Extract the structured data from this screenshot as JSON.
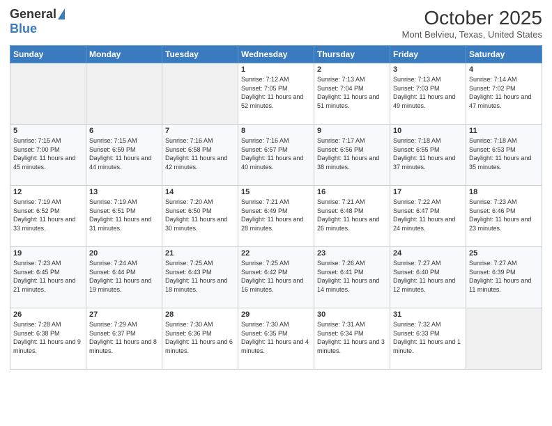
{
  "header": {
    "logo_general": "General",
    "logo_blue": "Blue",
    "month_title": "October 2025",
    "subtitle": "Mont Belvieu, Texas, United States"
  },
  "weekdays": [
    "Sunday",
    "Monday",
    "Tuesday",
    "Wednesday",
    "Thursday",
    "Friday",
    "Saturday"
  ],
  "weeks": [
    [
      {
        "day": "",
        "info": ""
      },
      {
        "day": "",
        "info": ""
      },
      {
        "day": "",
        "info": ""
      },
      {
        "day": "1",
        "info": "Sunrise: 7:12 AM\nSunset: 7:05 PM\nDaylight: 11 hours and 52 minutes."
      },
      {
        "day": "2",
        "info": "Sunrise: 7:13 AM\nSunset: 7:04 PM\nDaylight: 11 hours and 51 minutes."
      },
      {
        "day": "3",
        "info": "Sunrise: 7:13 AM\nSunset: 7:03 PM\nDaylight: 11 hours and 49 minutes."
      },
      {
        "day": "4",
        "info": "Sunrise: 7:14 AM\nSunset: 7:02 PM\nDaylight: 11 hours and 47 minutes."
      }
    ],
    [
      {
        "day": "5",
        "info": "Sunrise: 7:15 AM\nSunset: 7:00 PM\nDaylight: 11 hours and 45 minutes."
      },
      {
        "day": "6",
        "info": "Sunrise: 7:15 AM\nSunset: 6:59 PM\nDaylight: 11 hours and 44 minutes."
      },
      {
        "day": "7",
        "info": "Sunrise: 7:16 AM\nSunset: 6:58 PM\nDaylight: 11 hours and 42 minutes."
      },
      {
        "day": "8",
        "info": "Sunrise: 7:16 AM\nSunset: 6:57 PM\nDaylight: 11 hours and 40 minutes."
      },
      {
        "day": "9",
        "info": "Sunrise: 7:17 AM\nSunset: 6:56 PM\nDaylight: 11 hours and 38 minutes."
      },
      {
        "day": "10",
        "info": "Sunrise: 7:18 AM\nSunset: 6:55 PM\nDaylight: 11 hours and 37 minutes."
      },
      {
        "day": "11",
        "info": "Sunrise: 7:18 AM\nSunset: 6:53 PM\nDaylight: 11 hours and 35 minutes."
      }
    ],
    [
      {
        "day": "12",
        "info": "Sunrise: 7:19 AM\nSunset: 6:52 PM\nDaylight: 11 hours and 33 minutes."
      },
      {
        "day": "13",
        "info": "Sunrise: 7:19 AM\nSunset: 6:51 PM\nDaylight: 11 hours and 31 minutes."
      },
      {
        "day": "14",
        "info": "Sunrise: 7:20 AM\nSunset: 6:50 PM\nDaylight: 11 hours and 30 minutes."
      },
      {
        "day": "15",
        "info": "Sunrise: 7:21 AM\nSunset: 6:49 PM\nDaylight: 11 hours and 28 minutes."
      },
      {
        "day": "16",
        "info": "Sunrise: 7:21 AM\nSunset: 6:48 PM\nDaylight: 11 hours and 26 minutes."
      },
      {
        "day": "17",
        "info": "Sunrise: 7:22 AM\nSunset: 6:47 PM\nDaylight: 11 hours and 24 minutes."
      },
      {
        "day": "18",
        "info": "Sunrise: 7:23 AM\nSunset: 6:46 PM\nDaylight: 11 hours and 23 minutes."
      }
    ],
    [
      {
        "day": "19",
        "info": "Sunrise: 7:23 AM\nSunset: 6:45 PM\nDaylight: 11 hours and 21 minutes."
      },
      {
        "day": "20",
        "info": "Sunrise: 7:24 AM\nSunset: 6:44 PM\nDaylight: 11 hours and 19 minutes."
      },
      {
        "day": "21",
        "info": "Sunrise: 7:25 AM\nSunset: 6:43 PM\nDaylight: 11 hours and 18 minutes."
      },
      {
        "day": "22",
        "info": "Sunrise: 7:25 AM\nSunset: 6:42 PM\nDaylight: 11 hours and 16 minutes."
      },
      {
        "day": "23",
        "info": "Sunrise: 7:26 AM\nSunset: 6:41 PM\nDaylight: 11 hours and 14 minutes."
      },
      {
        "day": "24",
        "info": "Sunrise: 7:27 AM\nSunset: 6:40 PM\nDaylight: 11 hours and 12 minutes."
      },
      {
        "day": "25",
        "info": "Sunrise: 7:27 AM\nSunset: 6:39 PM\nDaylight: 11 hours and 11 minutes."
      }
    ],
    [
      {
        "day": "26",
        "info": "Sunrise: 7:28 AM\nSunset: 6:38 PM\nDaylight: 11 hours and 9 minutes."
      },
      {
        "day": "27",
        "info": "Sunrise: 7:29 AM\nSunset: 6:37 PM\nDaylight: 11 hours and 8 minutes."
      },
      {
        "day": "28",
        "info": "Sunrise: 7:30 AM\nSunset: 6:36 PM\nDaylight: 11 hours and 6 minutes."
      },
      {
        "day": "29",
        "info": "Sunrise: 7:30 AM\nSunset: 6:35 PM\nDaylight: 11 hours and 4 minutes."
      },
      {
        "day": "30",
        "info": "Sunrise: 7:31 AM\nSunset: 6:34 PM\nDaylight: 11 hours and 3 minutes."
      },
      {
        "day": "31",
        "info": "Sunrise: 7:32 AM\nSunset: 6:33 PM\nDaylight: 11 hours and 1 minute."
      },
      {
        "day": "",
        "info": ""
      }
    ]
  ]
}
